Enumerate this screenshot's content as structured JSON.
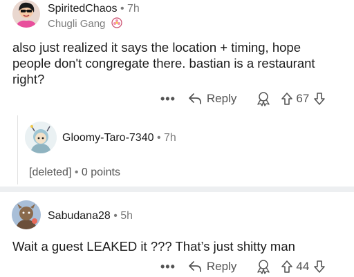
{
  "comment1": {
    "username": "SpiritedChaos",
    "time": "7h",
    "flair": "Chugli Gang",
    "body": "also just realized it says the location + timing, hope people don't congregate there. bastian is a restaurant right?",
    "actions": {
      "more": "•••",
      "reply": "Reply",
      "score": "67"
    }
  },
  "reply1": {
    "username": "Gloomy-Taro-7340",
    "time": "7h",
    "deleted": "[deleted]",
    "points": "0 points"
  },
  "comment2": {
    "username": "Sabudana28",
    "time": "5h",
    "body": "Wait a guest LEAKED it ??? That’s just shitty man",
    "actions": {
      "more": "•••",
      "reply": "Reply",
      "score": "44"
    }
  },
  "separator": "•",
  "icons": {
    "reply": "reply-arrow-icon",
    "award": "award-icon",
    "upvote": "upvote-arrow-icon",
    "downvote": "downvote-arrow-icon",
    "flair_emoji": "flower-emoji-icon"
  },
  "colors": {
    "divider": "#edeff1",
    "muted": "#7c7c7c",
    "icon": "#545454"
  }
}
